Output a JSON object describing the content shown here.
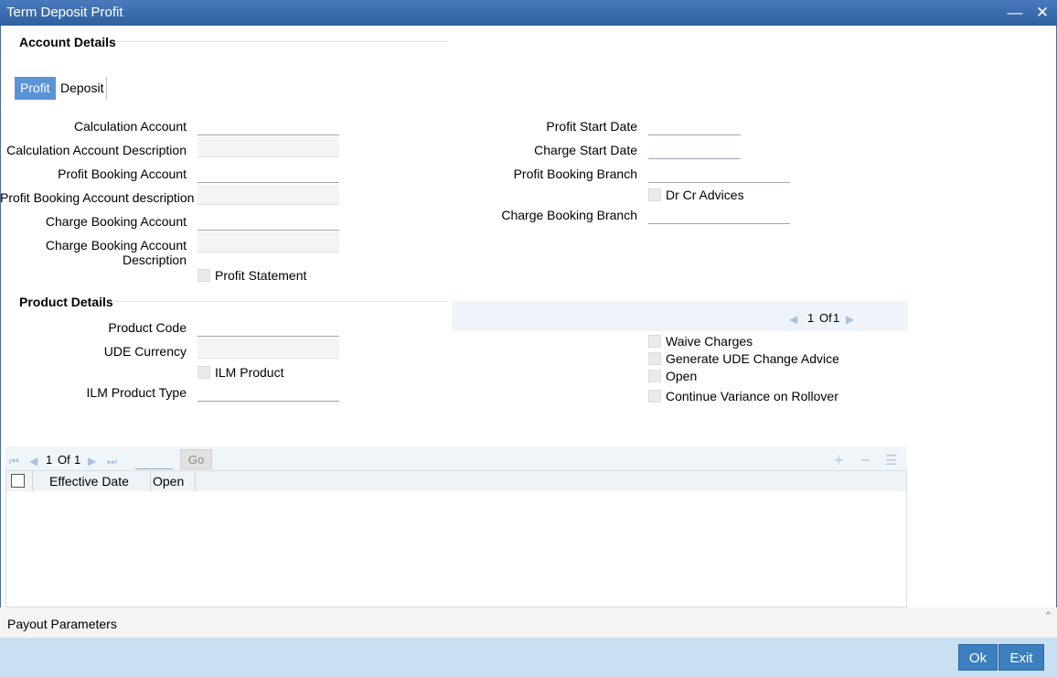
{
  "window": {
    "title": "Term Deposit Profit",
    "minimize_icon": "minimize-icon",
    "close_icon": "close-icon"
  },
  "account_details": {
    "title": "Account Details"
  },
  "tabs": [
    {
      "label": "Profit",
      "active": true
    },
    {
      "label": "Deposit",
      "active": false
    }
  ],
  "left_fields": {
    "calc_account": {
      "label": "Calculation Account",
      "value": ""
    },
    "calc_account_desc": {
      "label": "Calculation Account Description",
      "value": ""
    },
    "profit_booking_account": {
      "label": "Profit Booking Account",
      "value": ""
    },
    "profit_booking_account_desc": {
      "label": "Profit Booking Account description",
      "value": ""
    },
    "charge_booking_account": {
      "label": "Charge Booking Account",
      "value": ""
    },
    "charge_booking_account_desc": {
      "label_line1": "Charge Booking Account",
      "label_line2": "Description",
      "value": ""
    },
    "profit_statement": {
      "label": "Profit Statement",
      "checked": false
    }
  },
  "right_fields": {
    "profit_start_date": {
      "label": "Profit Start Date",
      "value": ""
    },
    "charge_start_date": {
      "label": "Charge Start Date",
      "value": ""
    },
    "profit_booking_branch": {
      "label": "Profit Booking Branch",
      "value": ""
    },
    "dr_cr_advices": {
      "label": "Dr Cr Advices",
      "checked": false
    },
    "charge_booking_branch": {
      "label": "Charge Booking Branch",
      "value": ""
    }
  },
  "product_details": {
    "title": "Product Details",
    "product_code": {
      "label": "Product Code",
      "value": ""
    },
    "ude_currency": {
      "label": "UDE Currency",
      "value": ""
    },
    "ilm_product": {
      "label": "ILM Product",
      "checked": false
    },
    "ilm_product_type": {
      "label": "ILM Product Type",
      "value": ""
    },
    "pager": {
      "current": "1",
      "of_label": "Of",
      "total": "1"
    },
    "waive_charges": {
      "label": "Waive Charges",
      "checked": false
    },
    "generate_ude_change_advice": {
      "label": "Generate UDE Change Advice",
      "checked": false
    },
    "open": {
      "label": "Open",
      "checked": false
    },
    "continue_variance": {
      "label": "Continue Variance on Rollover",
      "checked": false
    }
  },
  "grid": {
    "pager": {
      "current": "1",
      "of_label": "Of",
      "total": "1",
      "go_label": "Go",
      "page_input": ""
    },
    "columns": [
      "Effective Date",
      "Open"
    ],
    "rows": []
  },
  "payout": {
    "label": "Payout Parameters"
  },
  "buttons": {
    "ok": "Ok",
    "exit": "Exit"
  }
}
